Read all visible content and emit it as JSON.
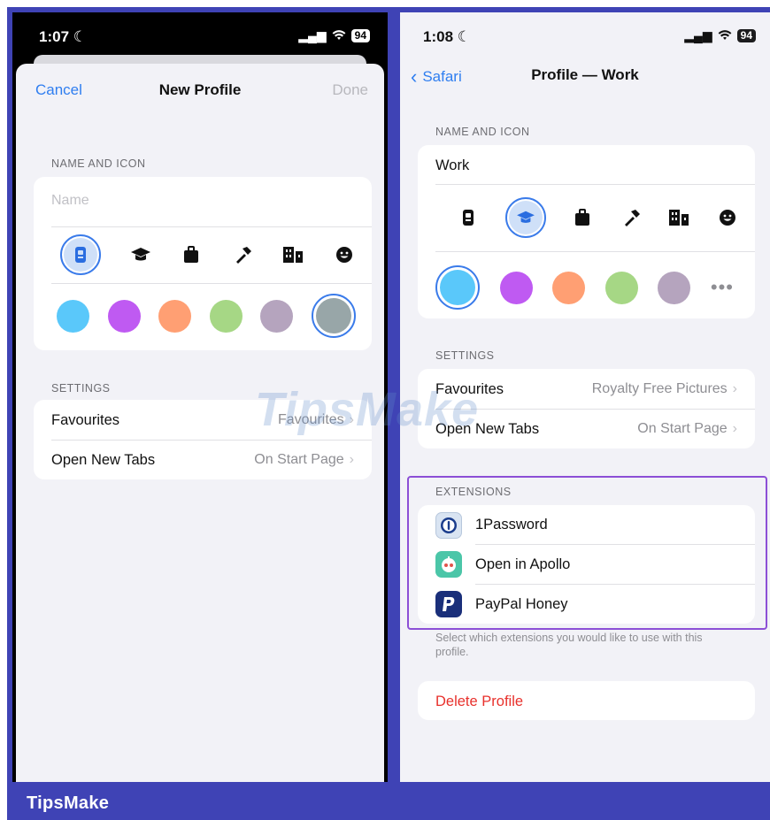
{
  "colors": {
    "frame": "#3f43b5",
    "accent": "#3a7bea",
    "link": "#2f7ef0",
    "destructive": "#e8312c",
    "extensions_highlight": "#8c4fd6"
  },
  "watermark": "TipsMake",
  "brand": "TipsMake",
  "left": {
    "status": {
      "time": "1:07",
      "battery": "94"
    },
    "nav": {
      "cancel": "Cancel",
      "title": "New Profile",
      "done": "Done"
    },
    "name_icon_section": "NAME AND ICON",
    "name_placeholder": "Name",
    "icons": [
      "id-badge-icon",
      "graduation-cap-icon",
      "briefcase-icon",
      "hammer-icon",
      "building-icon",
      "smiley-icon"
    ],
    "selected_icon": "id-badge-icon",
    "color_swatches": [
      "#5ac8fa",
      "#bf5af2",
      "#ff9f73",
      "#a6d785",
      "#b5a4be",
      "#98a6a8"
    ],
    "selected_color": 5,
    "settings_section": "SETTINGS",
    "settings": [
      {
        "label": "Favourites",
        "value": "Favourites"
      },
      {
        "label": "Open New Tabs",
        "value": "On Start Page"
      }
    ]
  },
  "right": {
    "status": {
      "time": "1:08",
      "battery": "94"
    },
    "nav": {
      "back": "Safari",
      "title": "Profile — Work"
    },
    "name_icon_section": "NAME AND ICON",
    "name_value": "Work",
    "icons": [
      "id-badge-icon",
      "graduation-cap-icon",
      "briefcase-icon",
      "hammer-icon",
      "building-icon",
      "smiley-icon"
    ],
    "selected_icon": "graduation-cap-icon",
    "color_swatches": [
      "#5ac8fa",
      "#bf5af2",
      "#ff9f73",
      "#a6d785",
      "#b5a4be"
    ],
    "selected_color": 0,
    "more_colors": "•••",
    "settings_section": "SETTINGS",
    "settings": [
      {
        "label": "Favourites",
        "value": "Royalty Free Pictures"
      },
      {
        "label": "Open New Tabs",
        "value": "On Start Page"
      }
    ],
    "extensions_section": "EXTENSIONS",
    "extensions": [
      {
        "label": "1Password",
        "icon": "1password-icon"
      },
      {
        "label": "Open in Apollo",
        "icon": "apollo-icon"
      },
      {
        "label": "PayPal Honey",
        "icon": "paypal-honey-icon"
      }
    ],
    "extensions_footnote": "Select which extensions you would like to use with this profile.",
    "delete": "Delete Profile"
  }
}
